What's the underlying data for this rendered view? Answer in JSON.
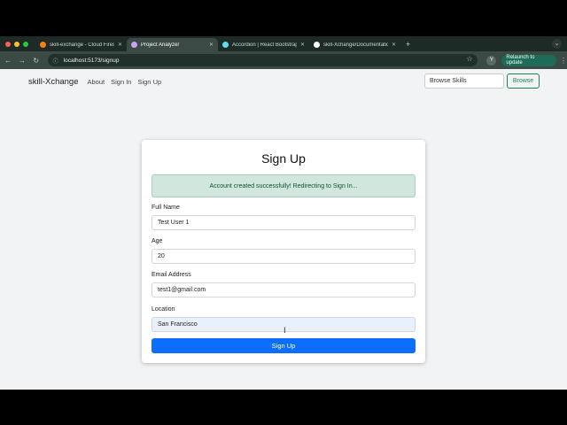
{
  "colors": {
    "accent": "#0d6efd",
    "success": "#198754",
    "alert_bg": "#d1e7dd",
    "chrome_bg": "#1e2a26"
  },
  "browser": {
    "tabs": [
      {
        "title": "skill-exchange - Cloud Firesto",
        "icon": "firebase-icon",
        "icon_color": "#f5820d"
      },
      {
        "title": "Project Analyzer",
        "icon": "project-icon",
        "icon_color": "#c9a3f5"
      },
      {
        "title": "Accordion | React Bootstrap",
        "icon": "react-icon",
        "icon_color": "#61dafb"
      },
      {
        "title": "skill-Xchange/Documentation",
        "icon": "github-icon",
        "icon_color": "#ffffff"
      }
    ],
    "url": "localhost:5173/signup",
    "profile_initial": "Y",
    "relaunch_label": "Relaunch to update"
  },
  "navbar": {
    "brand": "skill-Xchange",
    "links": [
      "About",
      "Sign In",
      "Sign Up"
    ],
    "search_value": "Browse Skills",
    "browse_label": "Browse"
  },
  "form": {
    "title": "Sign Up",
    "alert": "Account created successfully! Redirecting to Sign In...",
    "fields": [
      {
        "label": "Full Name",
        "value": "Test User 1"
      },
      {
        "label": "Age",
        "value": "20"
      },
      {
        "label": "Email Address",
        "value": "test1@gmail.com"
      },
      {
        "label": "Location",
        "value": "San Francisco"
      }
    ],
    "submit_label": "Sign Up"
  }
}
